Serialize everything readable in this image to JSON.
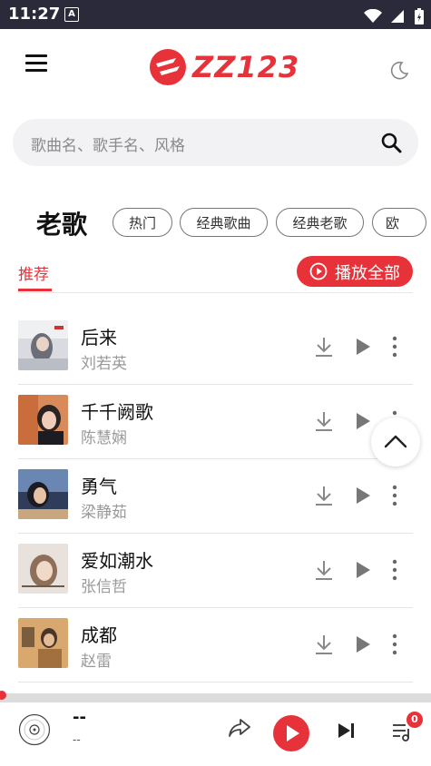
{
  "status_bar": {
    "time": "11:27",
    "sim_glyph": "A"
  },
  "header": {
    "logo_text": "ZZ123"
  },
  "search": {
    "placeholder": "歌曲名、歌手名、风格"
  },
  "category": {
    "title": "老歌",
    "chips": [
      "热门",
      "经典歌曲",
      "经典老歌",
      "欧"
    ]
  },
  "tabs": {
    "recommend_label": "推荐",
    "play_all_label": "播放全部"
  },
  "songs": [
    {
      "title": "后来",
      "artist": "刘若英"
    },
    {
      "title": "千千阙歌",
      "artist": "陈慧娴"
    },
    {
      "title": "勇气",
      "artist": "梁静茹"
    },
    {
      "title": "爱如潮水",
      "artist": "张信哲"
    },
    {
      "title": "成都",
      "artist": "赵雷"
    }
  ],
  "player": {
    "title": "--",
    "subtitle": "--",
    "queue_count": "0"
  },
  "colors": {
    "accent": "#e8323a",
    "status_bar": "#2a2a3a",
    "search_bg": "#f2f2f4"
  }
}
